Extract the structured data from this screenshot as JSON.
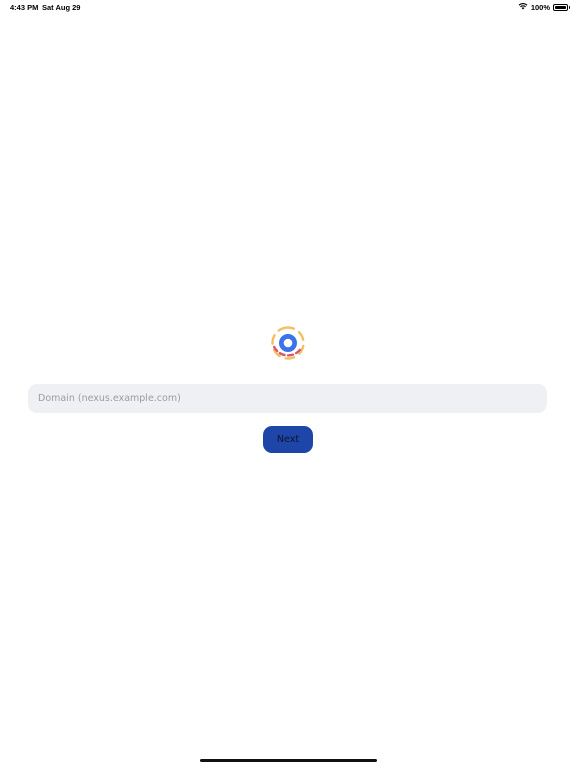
{
  "status_bar": {
    "time": "4:43 PM",
    "date": "Sat Aug 29",
    "battery_percent": "100%",
    "wifi_icon": "wifi-icon",
    "battery_icon": "battery-icon"
  },
  "logo": {
    "icon": "app-logo-icon",
    "colors": {
      "ring": "#3b74e8",
      "dash_top": "#f2c063",
      "dash_bottom": "#d8576e"
    }
  },
  "domain_input": {
    "value": "",
    "placeholder": "Domain (nexus.example.com)"
  },
  "next_button": {
    "label": "Next",
    "color": "#1e45a8"
  }
}
